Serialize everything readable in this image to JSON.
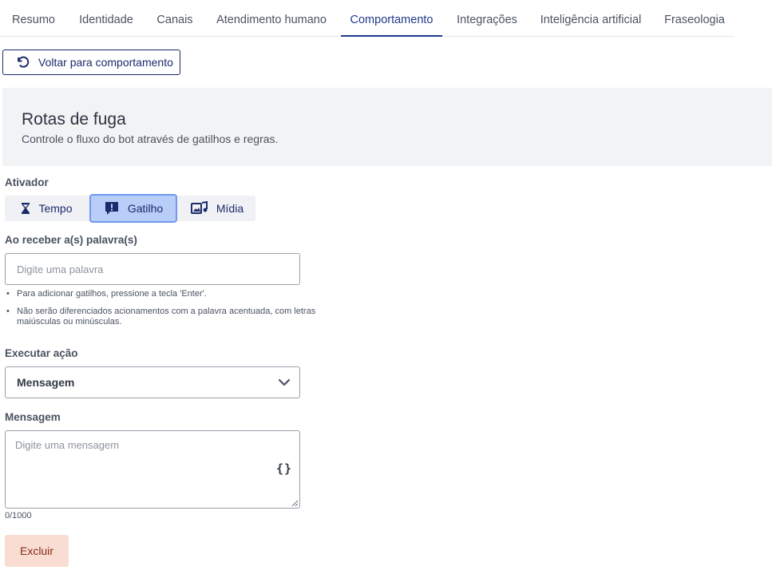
{
  "tabs": [
    {
      "label": "Resumo",
      "active": false
    },
    {
      "label": "Identidade",
      "active": false
    },
    {
      "label": "Canais",
      "active": false
    },
    {
      "label": "Atendimento humano",
      "active": false
    },
    {
      "label": "Comportamento",
      "active": true
    },
    {
      "label": "Integrações",
      "active": false
    },
    {
      "label": "Inteligência artificial",
      "active": false
    },
    {
      "label": "Fraseologia",
      "active": false
    }
  ],
  "back_button": {
    "label": "Voltar para comportamento",
    "icon": "undo-icon"
  },
  "banner": {
    "title": "Rotas de fuga",
    "subtitle": "Controle o fluxo do bot através de gatilhos e regras."
  },
  "activator": {
    "label": "Ativador",
    "options": [
      {
        "label": "Tempo",
        "icon": "hourglass-icon",
        "active": false
      },
      {
        "label": "Gatilho",
        "icon": "alert-chat-icon",
        "active": true
      },
      {
        "label": "Mídia",
        "icon": "media-icon",
        "active": false
      }
    ]
  },
  "trigger": {
    "label": "Ao receber a(s) palavra(s)",
    "placeholder": "Digite uma palavra",
    "hints": [
      "Para adicionar gatilhos, pressione a tecla 'Enter'.",
      "Não serão diferenciados acionamentos com a palavra acentuada, com letras maiúsculas ou minúsculas."
    ]
  },
  "action": {
    "label": "Executar ação",
    "value": "Mensagem"
  },
  "message": {
    "label": "Mensagem",
    "placeholder": "Digite uma mensagem",
    "variables_icon": "{}",
    "counter": "0/1000"
  },
  "delete_button": {
    "label": "Excluir"
  },
  "colors": {
    "accent": "#1f3a8a",
    "active_segment": "#b8cdf8",
    "danger_bg": "#f9ddd3"
  }
}
